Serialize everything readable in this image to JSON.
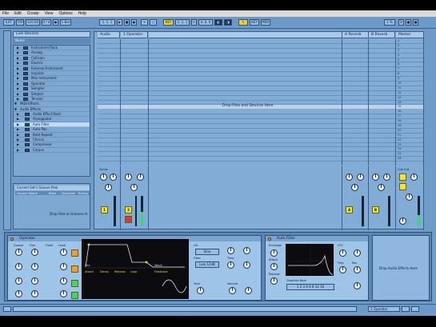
{
  "menu": [
    "File",
    "Edit",
    "Create",
    "View",
    "Options",
    "Help"
  ],
  "control_bar": {
    "time_signature": "4 / 4",
    "tempo_label": "120.00",
    "position": "1. 1. 1",
    "cpu": "1 %"
  },
  "browser": {
    "title": "Live Devices",
    "subheader": "Name",
    "items": [
      {
        "label": "Instrument Rack",
        "type": "folder"
      },
      {
        "label": "Analog",
        "type": "folder"
      },
      {
        "label": "Collision",
        "type": "folder"
      },
      {
        "label": "Electric",
        "type": "folder"
      },
      {
        "label": "External Instrument",
        "type": "folder"
      },
      {
        "label": "Impulse",
        "type": "folder"
      },
      {
        "label": "Max Instrument",
        "type": "folder"
      },
      {
        "label": "Operator",
        "type": "folder"
      },
      {
        "label": "Sampler",
        "type": "folder"
      },
      {
        "label": "Simpler",
        "type": "folder"
      },
      {
        "label": "Tension",
        "type": "folder"
      },
      {
        "label": "MIDI Effects",
        "type": "section"
      },
      {
        "label": "Audio Effects",
        "type": "section"
      },
      {
        "label": "Audio Effect Rack",
        "type": "sub"
      },
      {
        "label": "Arpeggiator",
        "type": "sub"
      },
      {
        "label": "Auto Filter",
        "type": "sub",
        "selected": true
      },
      {
        "label": "Auto Pan",
        "type": "sub"
      },
      {
        "label": "Beat Repeat",
        "type": "sub"
      },
      {
        "label": "Chorus",
        "type": "sub"
      },
      {
        "label": "Compressor",
        "type": "sub"
      },
      {
        "label": "Corpus",
        "type": "sub"
      }
    ]
  },
  "info_panel": {
    "title": "Current Set's Groove Pool",
    "columns": [
      "Groove Name",
      "Base",
      "Quantize",
      "Timing"
    ],
    "drop_text": "Drop Files or Grooves H"
  },
  "session": {
    "tracks": [
      {
        "name": "Audio",
        "number": "1"
      },
      {
        "name": "1 Operator",
        "number": "2"
      }
    ],
    "returns": [
      {
        "name": "A Reverb",
        "letter": "A"
      },
      {
        "name": "B Reverb",
        "letter": "B"
      }
    ],
    "master": {
      "name": "Master",
      "scenes": [
        "1",
        "2",
        "3",
        "4",
        "5",
        "6",
        "7",
        "8",
        "9",
        "10",
        "11",
        "12",
        "13",
        "14",
        "15",
        "16",
        "17",
        "18",
        "19",
        "20",
        "21",
        "22",
        "23",
        "24",
        "25",
        "26"
      ]
    },
    "drop_text": "Drop Files and Devices Here",
    "mixer_labels": {
      "sends": "Sends",
      "cue_out": "Cue Out",
      "master_out": "Master Out",
      "track_number": "1",
      "track2_number": "2"
    }
  },
  "devices": {
    "operator": {
      "title": "Operator",
      "oscillators": [
        "A",
        "B",
        "C",
        "D"
      ],
      "params": [
        "Coarse",
        "Fine",
        "Fixed",
        "Level"
      ],
      "section_labels": [
        "Envelope",
        "Lfo",
        "Filter",
        "Time",
        "Tone",
        "Volume"
      ],
      "display_values": [
        "Attack",
        "Decay",
        "Release",
        "Loop",
        "Feedback",
        "Osc",
        "Wave"
      ]
    },
    "auto_filter": {
      "title": "Auto Filter",
      "labels": [
        "Envelope",
        "Attack",
        "Release",
        "LFO",
        "Quantize Beat",
        "Freq",
        "Res"
      ]
    },
    "drop_text": "Drop Audio Effects Here"
  },
  "bottom_bar": {
    "selected_track": "1 Operator"
  }
}
